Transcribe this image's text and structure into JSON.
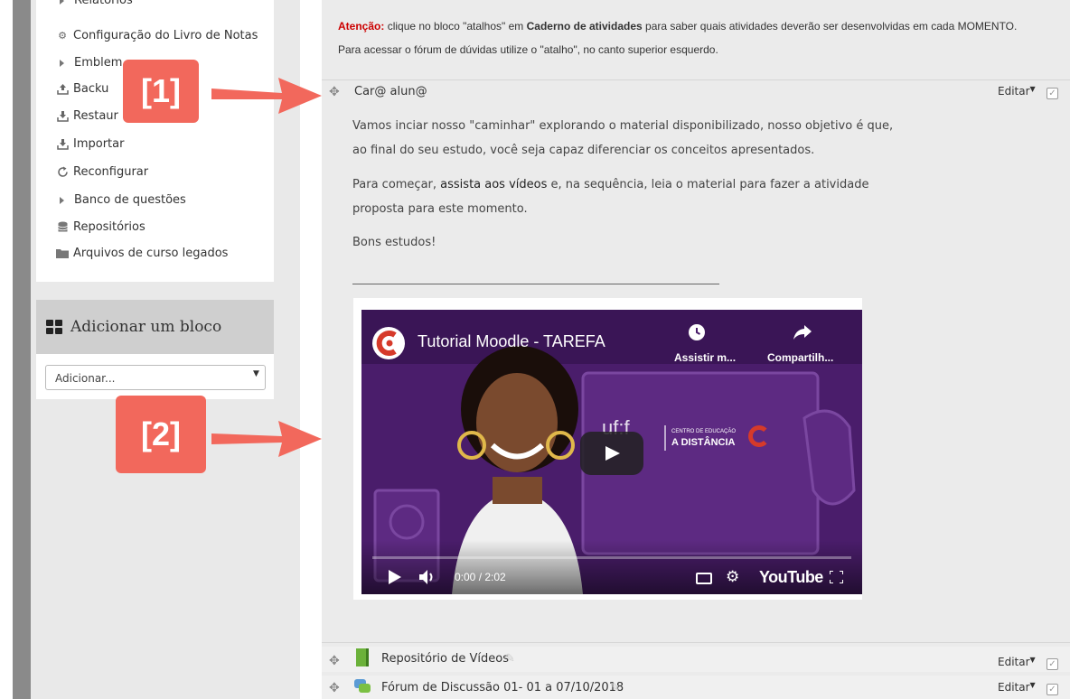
{
  "nav": {
    "items": [
      {
        "label": "Relatórios"
      },
      {
        "label": "Configuração do Livro de Notas"
      },
      {
        "label": "Emblem"
      },
      {
        "label": "Backu"
      },
      {
        "label": "Restaur"
      },
      {
        "label": "Importar"
      },
      {
        "label": "Reconfigurar"
      },
      {
        "label": "Banco de questões"
      },
      {
        "label": "Repositórios"
      },
      {
        "label": "Arquivos de curso legados"
      }
    ]
  },
  "add_block": {
    "title": "Adicionar um bloco",
    "select_value": "Adicionar..."
  },
  "notice": {
    "attention_label": "Atenção:",
    "line1_a": "clique no bloco \"atalhos\" em",
    "line1_bold": "Caderno de atividades",
    "line1_b": "para saber quais atividades deverão ser desenvolvidas em cada MOMENTO.",
    "line2_a": "Para acessar o",
    "line2_bold": "fórum de dúvidas",
    "line2_b": "utilize o \"atalho\", no canto superior esquerdo."
  },
  "section": {
    "title": "Car@ alun@",
    "edit_label": "Editar",
    "para1_line1": "Vamos inciar nosso \"caminhar\" explorando o material disponibilizado, nosso objetivo é que,",
    "para1_line2": "ao final do seu estudo, você seja capaz diferenciar os conceitos apresentados.",
    "para2_line1_a": "Para começar,",
    "para2_line1_bold": "assista aos vídeos",
    "para2_line1_b": "e, na sequência, leia o material para fazer a atividade",
    "para2_line2": "proposta para este momento.",
    "para3": "Bons estudos!"
  },
  "video": {
    "title": "Tutorial Moodle - TAREFA",
    "watch_later": "Assistir m...",
    "share": "Compartilh...",
    "time": "0:00 / 2:02",
    "brand": "YouTube",
    "ufjf": "uf:f",
    "cead_small": "CENTRO DE EDUCAÇÃO",
    "cead_big": "A DISTÂNCIA"
  },
  "activities": [
    {
      "label": "Repositório de Vídeos",
      "edit_label": "Editar"
    },
    {
      "label": "Fórum de Discussão 01- 01 a 07/10/2018",
      "edit_label": "Editar"
    }
  ],
  "annotations": {
    "label1": "[1]",
    "label2": "[2]"
  },
  "colors": {
    "annotation": "#f2685c",
    "attention": "#cc0000",
    "video_bg": "#4a1d6b"
  }
}
